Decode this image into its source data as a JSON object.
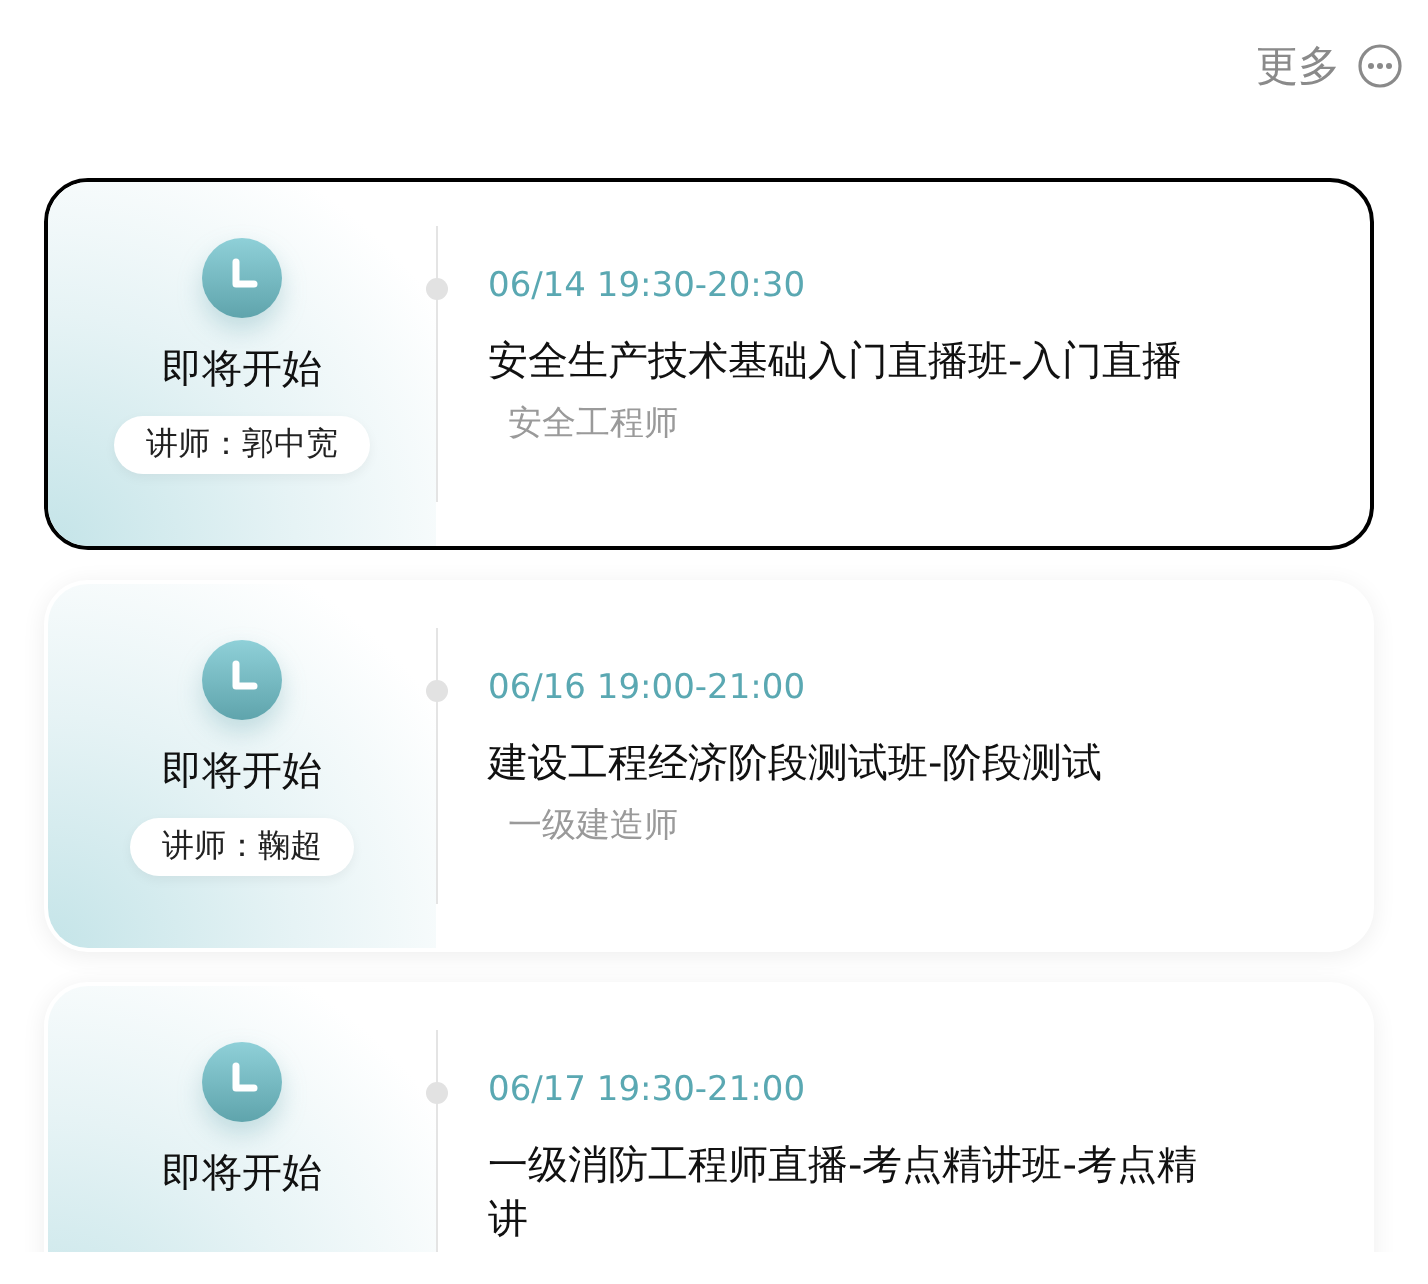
{
  "more": {
    "label": "更多"
  },
  "sessions": [
    {
      "status": "即将开始",
      "lecturer": "讲师：郭中宽",
      "time": "06/14 19:30-20:30",
      "title": "安全生产技术基础入门直播班-入门直播",
      "category": "安全工程师",
      "selected": true
    },
    {
      "status": "即将开始",
      "lecturer": "讲师：鞠超",
      "time": "06/16 19:00-21:00",
      "title": "建设工程经济阶段测试班-阶段测试",
      "category": "一级建造师",
      "selected": false
    },
    {
      "status": "即将开始",
      "time": "06/17 19:30-21:00",
      "title": "一级消防工程师直播-考点精讲班-考点精讲",
      "selected": false
    }
  ]
}
